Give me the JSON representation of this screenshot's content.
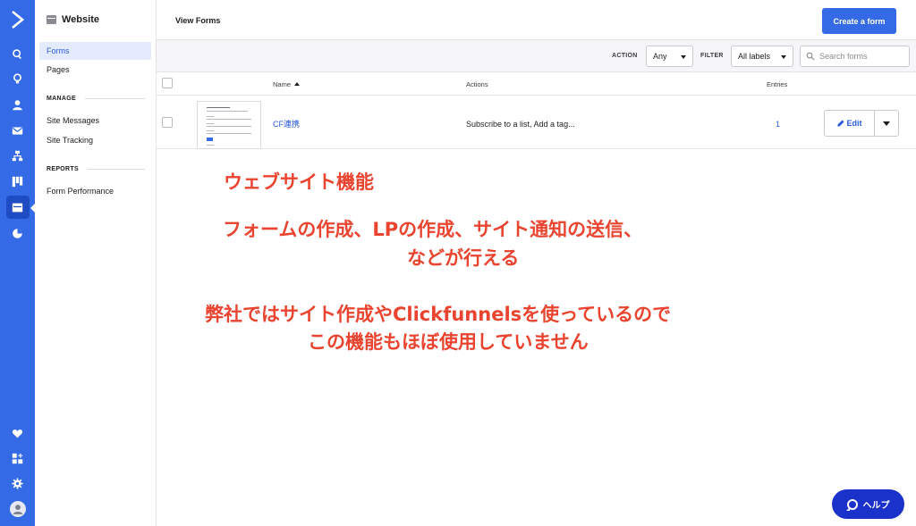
{
  "rail": {
    "icons": [
      "activecampaign-logo-icon",
      "search-icon",
      "lightbulb-icon",
      "contact-icon",
      "mail-icon",
      "automation-icon",
      "deals-pipeline-icon",
      "website-icon",
      "reports-pie-icon",
      "heart-icon",
      "apps-add-icon",
      "settings-gear-icon",
      "user-avatar-icon"
    ],
    "active": "website-icon",
    "accent_color": "#356ae6"
  },
  "sidebar": {
    "title": "Website",
    "items": [
      {
        "label": "Forms",
        "active": true
      },
      {
        "label": "Pages",
        "active": false
      }
    ],
    "sections": [
      {
        "title": "MANAGE",
        "items": [
          {
            "label": "Site Messages"
          },
          {
            "label": "Site Tracking"
          }
        ]
      },
      {
        "title": "REPORTS",
        "items": [
          {
            "label": "Form Performance"
          }
        ]
      }
    ]
  },
  "header": {
    "title": "View Forms",
    "create_button": "Create a form"
  },
  "filters": {
    "action_label": "ACTION",
    "action_value": "Any",
    "filter_label": "FILTER",
    "filter_value": "All labels",
    "search_placeholder": "Search forms"
  },
  "table": {
    "columns": [
      "Name",
      "Actions",
      "Entries"
    ],
    "sorted_by": "Name",
    "rows": [
      {
        "name": "CF連携",
        "actions": "Subscribe to a list, Add a tag...",
        "entries": "1",
        "edit_label": "Edit"
      }
    ]
  },
  "annotations": [
    "ウェブサイト機能",
    "フォームの作成、LPの作成、サイト通知の送信、",
    "などが行える",
    "弊社ではサイト作成やClickfunnelsを使っているので",
    "この機能もほぼ使用していません"
  ],
  "help": {
    "label": "ヘルプ"
  },
  "colors": {
    "annotation": "#e9442f",
    "link": "#2a5ad8",
    "help": "#1a32c9"
  }
}
